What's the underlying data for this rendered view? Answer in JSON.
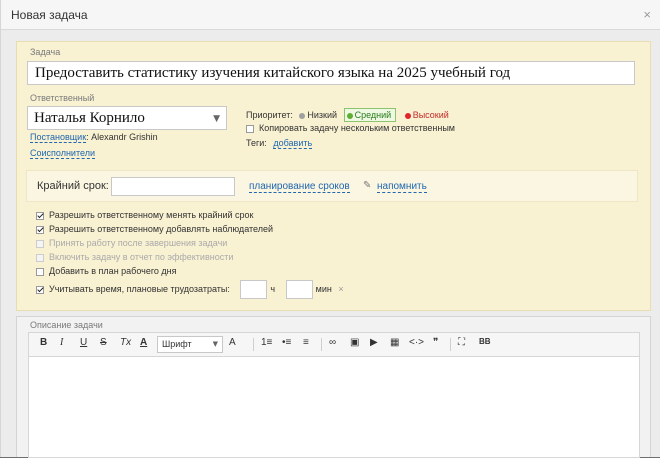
{
  "dialog": {
    "title": "Новая задача",
    "close_symbol": "×"
  },
  "task": {
    "label": "Задача",
    "value": "Предоставить статистику изучения китайского языка на 2025 учебный год"
  },
  "responsible": {
    "label": "Ответственный",
    "value": "Наталья Корнило",
    "creator_label": "Постановщик",
    "creator_name": "Alexandr Grishin",
    "coexecutors": "Соисполнители"
  },
  "priority": {
    "label": "Приоритет:",
    "options": [
      {
        "label": "Низкий",
        "color": "#a0a0a0"
      },
      {
        "label": "Средний",
        "color": "#5fae34",
        "selected": true
      },
      {
        "label": "Высокий",
        "color": "#e0262b"
      }
    ]
  },
  "copy_task": "Копировать задачу нескольким ответственным",
  "tags": {
    "label": "Теги:",
    "add": "добавить"
  },
  "deadline": {
    "label": "Крайний срок:",
    "value": "",
    "plan_link": "планирование сроков",
    "remind_link": "напомнить"
  },
  "options": [
    {
      "label": "Разрешить ответственному менять крайний срок",
      "checked": true,
      "disabled": false
    },
    {
      "label": "Разрешить ответственному добавлять наблюдателей",
      "checked": true,
      "disabled": false
    },
    {
      "label": "Принять работу после завершения задачи",
      "checked": false,
      "disabled": true
    },
    {
      "label": "Включить задачу в отчет по эффективности",
      "checked": false,
      "disabled": true
    },
    {
      "label": "Добавить в план рабочего дня",
      "checked": false,
      "disabled": false
    }
  ],
  "time_tracking": {
    "label": "Учитывать время, плановые трудозатраты:",
    "checked": true,
    "hours_unit": "ч",
    "minutes_unit": "мин",
    "clear_symbol": "×"
  },
  "description": {
    "label": "Описание задачи",
    "toolbar": {
      "bold": "B",
      "italic": "I",
      "underline": "U",
      "strike": "S",
      "clear_format": "Tx",
      "font_color": "A",
      "font_select": "Шрифт",
      "font_size": "A",
      "numbered_list": "1≡",
      "bullet_list": "•≡",
      "align": "≡",
      "link": "∞",
      "image": "▣",
      "video": "▶",
      "table": "▦",
      "source": "<·>",
      "quote": "❞",
      "fullscreen": "⛶",
      "bbcode": "BB"
    }
  }
}
